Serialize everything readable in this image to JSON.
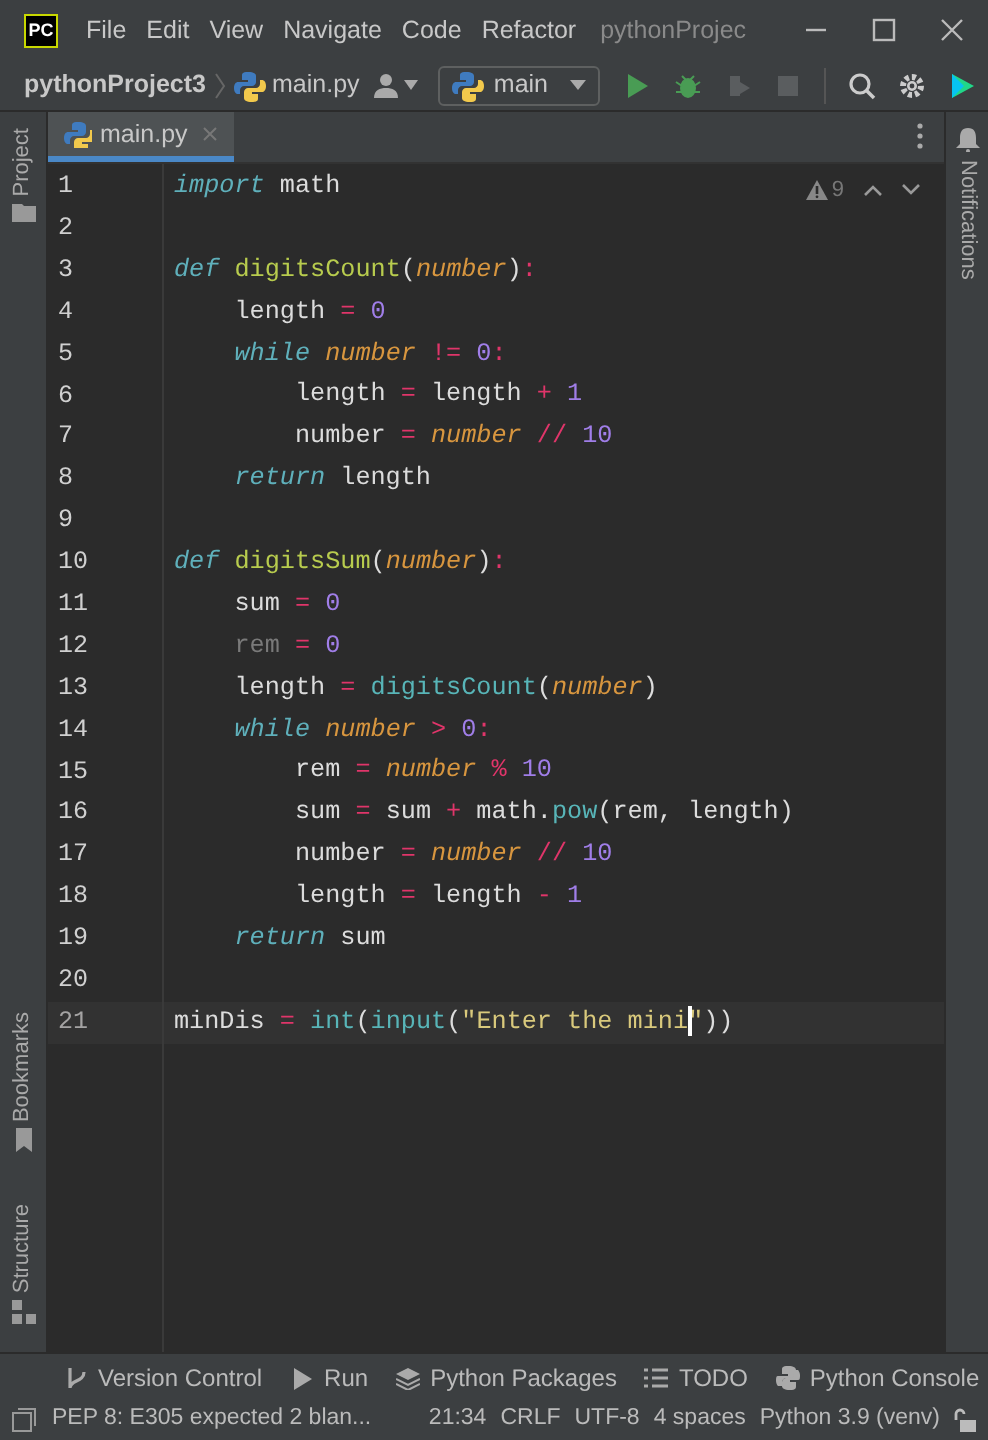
{
  "window": {
    "app_icon": "PC",
    "menu": [
      "File",
      "Edit",
      "View",
      "Navigate",
      "Code",
      "Refactor"
    ],
    "title": "pythonProjec"
  },
  "navbar": {
    "breadcrumbs": [
      "pythonProject3",
      "main.py"
    ],
    "run_config": "main"
  },
  "tabs": [
    {
      "label": "main.py",
      "selected": true
    }
  ],
  "left_tool_windows": [
    "Project",
    "Bookmarks",
    "Structure"
  ],
  "right_tool_windows": [
    "Notifications"
  ],
  "editor": {
    "inspection_count": "9",
    "lines": [
      {
        "number": "1",
        "current": false,
        "tokens": [
          {
            "text": "import",
            "kind": "keyword"
          },
          {
            "text": " math",
            "kind": "plain"
          }
        ]
      },
      {
        "number": "2",
        "current": false
      },
      {
        "number": "3",
        "current": false,
        "tokens": [
          {
            "text": "def",
            "kind": "keyword"
          },
          {
            "text": " digitsCount",
            "kind": "function"
          },
          {
            "text": "(",
            "kind": "plain"
          },
          {
            "text": "number",
            "kind": "param"
          },
          {
            "text": ")",
            "kind": "plain"
          },
          {
            "text": ":",
            "kind": "operator"
          }
        ]
      },
      {
        "number": "4",
        "current": false,
        "tokens": [
          {
            "text": "    length",
            "kind": "plain"
          },
          {
            "text": " =",
            "kind": "operator"
          },
          {
            "text": " 0",
            "kind": "number"
          }
        ]
      },
      {
        "number": "5",
        "current": false,
        "tokens": [
          {
            "text": "    while",
            "kind": "keyword"
          },
          {
            "text": " number",
            "kind": "param"
          },
          {
            "text": " !=",
            "kind": "operator"
          },
          {
            "text": " 0",
            "kind": "number"
          },
          {
            "text": ":",
            "kind": "operator"
          }
        ]
      },
      {
        "number": "6",
        "current": false,
        "tokens": [
          {
            "text": "        length",
            "kind": "plain"
          },
          {
            "text": " =",
            "kind": "operator"
          },
          {
            "text": " length",
            "kind": "plain"
          },
          {
            "text": " +",
            "kind": "operator"
          },
          {
            "text": " 1",
            "kind": "number"
          }
        ]
      },
      {
        "number": "7",
        "current": false,
        "tokens": [
          {
            "text": "        number",
            "kind": "plain"
          },
          {
            "text": " =",
            "kind": "operator"
          },
          {
            "text": " number",
            "kind": "param"
          },
          {
            "text": " //",
            "kind": "operator"
          },
          {
            "text": " 10",
            "kind": "number"
          }
        ]
      },
      {
        "number": "8",
        "current": false,
        "tokens": [
          {
            "text": "    return",
            "kind": "keyword"
          },
          {
            "text": " length",
            "kind": "plain"
          }
        ]
      },
      {
        "number": "9",
        "current": false
      },
      {
        "number": "10",
        "current": false,
        "tokens": [
          {
            "text": "def",
            "kind": "keyword"
          },
          {
            "text": " digitsSum",
            "kind": "function"
          },
          {
            "text": "(",
            "kind": "plain"
          },
          {
            "text": "number",
            "kind": "param"
          },
          {
            "text": ")",
            "kind": "plain"
          },
          {
            "text": ":",
            "kind": "operator"
          }
        ]
      },
      {
        "number": "11",
        "current": false,
        "tokens": [
          {
            "text": "    sum",
            "kind": "plain"
          },
          {
            "text": " =",
            "kind": "operator"
          },
          {
            "text": " 0",
            "kind": "number"
          }
        ]
      },
      {
        "number": "12",
        "current": false,
        "tokens": [
          {
            "text": "    rem",
            "kind": "unused"
          },
          {
            "text": " =",
            "kind": "operator"
          },
          {
            "text": " 0",
            "kind": "number"
          }
        ]
      },
      {
        "number": "13",
        "current": false,
        "tokens": [
          {
            "text": "    length",
            "kind": "plain"
          },
          {
            "text": " =",
            "kind": "operator"
          },
          {
            "text": " digitsCount",
            "kind": "call"
          },
          {
            "text": "(",
            "kind": "plain"
          },
          {
            "text": "number",
            "kind": "param"
          },
          {
            "text": ")",
            "kind": "plain"
          }
        ]
      },
      {
        "number": "14",
        "current": false,
        "tokens": [
          {
            "text": "    while",
            "kind": "keyword"
          },
          {
            "text": " number",
            "kind": "param"
          },
          {
            "text": " >",
            "kind": "operator"
          },
          {
            "text": " 0",
            "kind": "number"
          },
          {
            "text": ":",
            "kind": "operator"
          }
        ]
      },
      {
        "number": "15",
        "current": false,
        "tokens": [
          {
            "text": "        rem",
            "kind": "plain"
          },
          {
            "text": " =",
            "kind": "operator"
          },
          {
            "text": " number",
            "kind": "param"
          },
          {
            "text": " %",
            "kind": "operator"
          },
          {
            "text": " 10",
            "kind": "number"
          }
        ]
      },
      {
        "number": "16",
        "current": false,
        "tokens": [
          {
            "text": "        sum",
            "kind": "plain"
          },
          {
            "text": " =",
            "kind": "operator"
          },
          {
            "text": " sum",
            "kind": "plain"
          },
          {
            "text": " +",
            "kind": "operator"
          },
          {
            "text": " math.",
            "kind": "plain"
          },
          {
            "text": "pow",
            "kind": "call"
          },
          {
            "text": "(rem, length)",
            "kind": "plain"
          }
        ]
      },
      {
        "number": "17",
        "current": false,
        "tokens": [
          {
            "text": "        number",
            "kind": "plain"
          },
          {
            "text": " =",
            "kind": "operator"
          },
          {
            "text": " number",
            "kind": "param"
          },
          {
            "text": " //",
            "kind": "operator"
          },
          {
            "text": " 10",
            "kind": "number"
          }
        ]
      },
      {
        "number": "18",
        "current": false,
        "tokens": [
          {
            "text": "        length",
            "kind": "plain"
          },
          {
            "text": " =",
            "kind": "operator"
          },
          {
            "text": " length",
            "kind": "plain"
          },
          {
            "text": " -",
            "kind": "operator"
          },
          {
            "text": " 1",
            "kind": "number"
          }
        ]
      },
      {
        "number": "19",
        "current": false,
        "tokens": [
          {
            "text": "    return",
            "kind": "keyword"
          },
          {
            "text": " sum",
            "kind": "plain"
          }
        ]
      },
      {
        "number": "20",
        "current": false
      },
      {
        "number": "21",
        "current": true,
        "tokens": [
          {
            "text": "minDis",
            "kind": "plain"
          },
          {
            "text": " =",
            "kind": "operator"
          },
          {
            "text": " int",
            "kind": "call"
          },
          {
            "text": "(",
            "kind": "plain"
          },
          {
            "text": "input",
            "kind": "call"
          },
          {
            "text": "(",
            "kind": "plain"
          },
          {
            "text": "\"Enter the mini",
            "kind": "string"
          },
          {
            "text": "\"",
            "kind": "string",
            "caret_before": true
          },
          {
            "text": "))",
            "kind": "plain"
          }
        ]
      }
    ]
  },
  "tool_window_bar": [
    {
      "label": "Version Control",
      "kind": "vcs"
    },
    {
      "label": "Run",
      "kind": "run"
    },
    {
      "label": "Python Packages",
      "kind": "packages"
    },
    {
      "label": "TODO",
      "kind": "todo"
    },
    {
      "label": "Python Console",
      "kind": "console"
    }
  ],
  "status_bar": {
    "message": "PEP 8: E305 expected 2 blan...",
    "items": [
      "21:34",
      "CRLF",
      "UTF-8",
      "4 spaces",
      "Python 3.9 (venv)"
    ]
  }
}
